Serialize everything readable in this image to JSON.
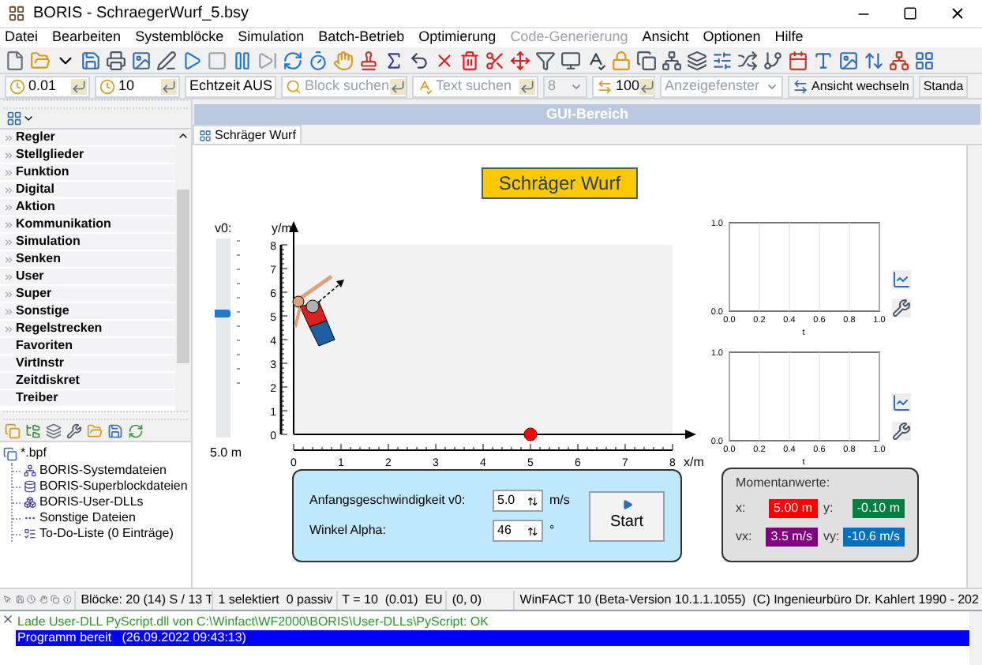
{
  "window": {
    "title": "BORIS - SchraegerWurf_5.bsy"
  },
  "menu": [
    {
      "label": "Datei",
      "disabled": false
    },
    {
      "label": "Bearbeiten",
      "disabled": false
    },
    {
      "label": "Systemblöcke",
      "disabled": false
    },
    {
      "label": "Simulation",
      "disabled": false
    },
    {
      "label": "Batch-Betrieb",
      "disabled": false
    },
    {
      "label": "Optimierung",
      "disabled": false
    },
    {
      "label": "Code-Generierung",
      "disabled": true
    },
    {
      "label": "Ansicht",
      "disabled": false
    },
    {
      "label": "Optionen",
      "disabled": false
    },
    {
      "label": "Hilfe",
      "disabled": false
    }
  ],
  "toolbar2": [
    {
      "kind": "field",
      "value": "0.01",
      "disabled": false
    },
    {
      "kind": "field",
      "value": "10",
      "disabled": false
    },
    {
      "kind": "select",
      "value": "Echtzeit AUS",
      "disabled": false
    },
    {
      "kind": "search",
      "placeholder": "Block suchen",
      "disabled": false
    },
    {
      "kind": "search",
      "placeholder": "Text suchen",
      "disabled": false
    },
    {
      "kind": "select",
      "value": "8",
      "disabled": true
    },
    {
      "kind": "field",
      "value": "100",
      "disabled": false
    },
    {
      "kind": "select",
      "placeholder": "Anzeigefenster",
      "disabled": false
    },
    {
      "kind": "button",
      "label": "Ansicht wechseln",
      "disabled": false
    },
    {
      "kind": "button",
      "label": "Standa",
      "disabled": false
    }
  ],
  "sidebar": {
    "categories": [
      {
        "label": "Regler",
        "expandable": true
      },
      {
        "label": "Stellglieder",
        "expandable": true
      },
      {
        "label": "Funktion",
        "expandable": true
      },
      {
        "label": "Digital",
        "expandable": true
      },
      {
        "label": "Aktion",
        "expandable": true
      },
      {
        "label": "Kommunikation",
        "expandable": true
      },
      {
        "label": "Simulation",
        "expandable": true
      },
      {
        "label": "Senken",
        "expandable": true
      },
      {
        "label": "User",
        "expandable": true
      },
      {
        "label": "Super",
        "expandable": true
      },
      {
        "label": "Sonstige",
        "expandable": true
      },
      {
        "label": "Regelstrecken",
        "expandable": true
      },
      {
        "label": "Favoriten",
        "expandable": false
      },
      {
        "label": "VirtInstr",
        "expandable": false
      },
      {
        "label": "Zeitdiskret",
        "expandable": false
      },
      {
        "label": "Treiber",
        "expandable": false
      }
    ],
    "tree": {
      "label": "*.bpf",
      "children": [
        {
          "label": "BORIS-Systemdateien"
        },
        {
          "label": "BORIS-Superblockdateien"
        },
        {
          "label": "BORIS-User-DLLs"
        },
        {
          "label": "Sonstige Dateien"
        },
        {
          "label": "To-Do-Liste (0 Einträge)"
        }
      ]
    }
  },
  "workspace": {
    "header": "GUI-Bereich",
    "tabs": [
      {
        "label": "Schräger Wurf",
        "selected": true
      }
    ],
    "title": "Schräger Wurf",
    "slider": {
      "label": "v0:",
      "level": 0.62,
      "reading": "5.0 m"
    },
    "plot": {
      "chart_data": {
        "type": "scatter",
        "xlabel": "x/m",
        "ylabel": "y/m",
        "x": [
          5
        ],
        "series": [
          {
            "color": "#ff0000",
            "values": [
              0
            ]
          }
        ],
        "xlim": [
          0,
          8
        ],
        "ylim": [
          0,
          8
        ],
        "xticks": [
          {
            "value": 0,
            "label": "0"
          },
          {
            "value": 1,
            "label": "1"
          },
          {
            "value": 2,
            "label": "2"
          },
          {
            "value": 3,
            "label": "3"
          },
          {
            "value": 4,
            "label": "4"
          },
          {
            "value": 5,
            "label": "5"
          },
          {
            "value": 6,
            "label": "6"
          },
          {
            "value": 7,
            "label": "7"
          },
          {
            "value": 8,
            "label": "8"
          }
        ],
        "yticks": [
          {
            "value": 0,
            "label": "0"
          },
          {
            "value": 1,
            "label": "1"
          },
          {
            "value": 2,
            "label": "2"
          },
          {
            "value": 3,
            "label": "3"
          },
          {
            "value": 4,
            "label": "4"
          },
          {
            "value": 5,
            "label": "5"
          },
          {
            "value": 6,
            "label": "6"
          },
          {
            "value": 7,
            "label": "7"
          },
          {
            "value": 8,
            "label": "8"
          }
        ]
      }
    },
    "inputs": [
      {
        "label": "Anfangsgeschwindigkeit v0:",
        "value": "5.0",
        "unit": "m/s"
      },
      {
        "label": "Winkel Alpha:",
        "value": "46",
        "unit": "°"
      }
    ],
    "start_button": "Start",
    "readouts": {
      "title": "Momentanwerte:",
      "items": [
        {
          "label": "x:",
          "value": "5.00 m",
          "color": "#ff0000"
        },
        {
          "label": "y:",
          "value": "-0.10 m",
          "color": "#008040"
        },
        {
          "label": "vx:",
          "value": "3.5 m/s",
          "color": "#800080"
        },
        {
          "label": "vy:",
          "value": "-10.6 m/s",
          "color": "#0070c0"
        }
      ]
    },
    "charts": [
      {
        "y_labels": [
          "1.0",
          "0.0"
        ],
        "x_labels": [
          "0.0",
          "0.2",
          "0.4",
          "0.6",
          "0.8",
          "1.0"
        ],
        "x_title": "t"
      },
      {
        "y_labels": [
          "1.0",
          "0.0"
        ],
        "x_labels": [
          "0.0",
          "0.2",
          "0.4",
          "0.6",
          "0.8",
          "1.0"
        ],
        "x_title": "t"
      }
    ]
  },
  "status_bar": {
    "fields": [
      "Blöcke: 20 (14) S / 13 T",
      "1 selektiert  0 passiv",
      "T = 10  (0.01)  EU",
      "(0, 0)",
      "WinFACT 10 (Beta-Version 10.1.1.1055)  (C) Ingenieurbüro Dr. Kahlert 1990 - 202"
    ]
  },
  "log": [
    {
      "text": "Lade User-DLL PyScript.dll von C:\\Winfact\\WF2000\\BORIS\\User-DLLs\\PyScript: OK",
      "selected": false
    },
    {
      "text": "Programm bereit   (26.09.2022 09:43:13)",
      "selected": true
    }
  ]
}
